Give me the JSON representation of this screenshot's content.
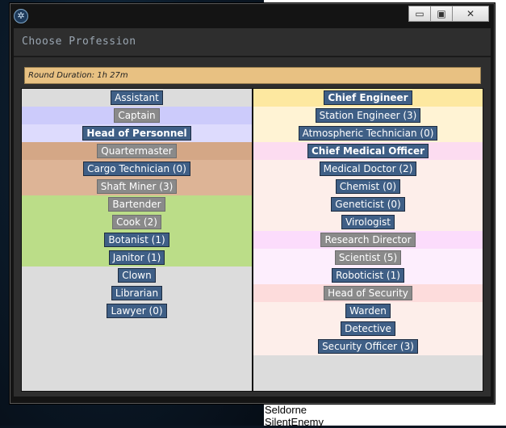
{
  "window": {
    "title": "Choose Profession",
    "minimize_label": "▭",
    "maximize_label": "▣",
    "close_label": "✕"
  },
  "round_duration": "Round Duration: 1h 27m",
  "columns": {
    "left": [
      {
        "label": "Assistant",
        "state": "open",
        "bg": "#dcdcdc"
      },
      {
        "label": "Captain",
        "state": "closed",
        "bg": "#cccbfb"
      },
      {
        "label": "Head of Personnel",
        "state": "head",
        "bg": "#dddbfd"
      },
      {
        "label": "Quartermaster",
        "state": "closed",
        "bg": "#d4a786"
      },
      {
        "label": "Cargo Technician (0)",
        "state": "open",
        "bg": "#ddb496"
      },
      {
        "label": "Shaft Miner (3)",
        "state": "closed",
        "bg": "#ddb496"
      },
      {
        "label": "Bartender",
        "state": "closed",
        "bg": "#bbdd88"
      },
      {
        "label": "Cook (2)",
        "state": "closed",
        "bg": "#bbdd88"
      },
      {
        "label": "Botanist (1)",
        "state": "open",
        "bg": "#bbdd88"
      },
      {
        "label": "Janitor (1)",
        "state": "open",
        "bg": "#bbdd88"
      },
      {
        "label": "Clown",
        "state": "open",
        "bg": "#dcdcdc"
      },
      {
        "label": "Librarian",
        "state": "open",
        "bg": "#dcdcdc"
      },
      {
        "label": "Lawyer (0)",
        "state": "open",
        "bg": "#dcdcdc"
      }
    ],
    "right": [
      {
        "label": "Chief Engineer",
        "state": "head",
        "bg": "#fde8a0"
      },
      {
        "label": "Station Engineer (3)",
        "state": "open",
        "bg": "#fff3d4"
      },
      {
        "label": "Atmospheric Technician (0)",
        "state": "open",
        "bg": "#fff3d4"
      },
      {
        "label": "Chief Medical Officer",
        "state": "head",
        "bg": "#fcdcf0"
      },
      {
        "label": "Medical Doctor (2)",
        "state": "open",
        "bg": "#fdeeea"
      },
      {
        "label": "Chemist (0)",
        "state": "open",
        "bg": "#fdeeea"
      },
      {
        "label": "Geneticist (0)",
        "state": "open",
        "bg": "#fdeeea"
      },
      {
        "label": "Virologist",
        "state": "open",
        "bg": "#fdeeea"
      },
      {
        "label": "Research Director",
        "state": "closed",
        "bg": "#fcdcfc"
      },
      {
        "label": "Scientist (5)",
        "state": "closed",
        "bg": "#fdeefd"
      },
      {
        "label": "Roboticist (1)",
        "state": "open",
        "bg": "#fdeefd"
      },
      {
        "label": "Head of Security",
        "state": "closed",
        "bg": "#fddcdc"
      },
      {
        "label": "Warden",
        "state": "open",
        "bg": "#fdeeea"
      },
      {
        "label": "Detective",
        "state": "open",
        "bg": "#fdeeea"
      },
      {
        "label": "Security Officer (3)",
        "state": "open",
        "bg": "#fdeeea"
      }
    ]
  },
  "background_names": [
    "Seldorne",
    "SilentEnemy"
  ]
}
